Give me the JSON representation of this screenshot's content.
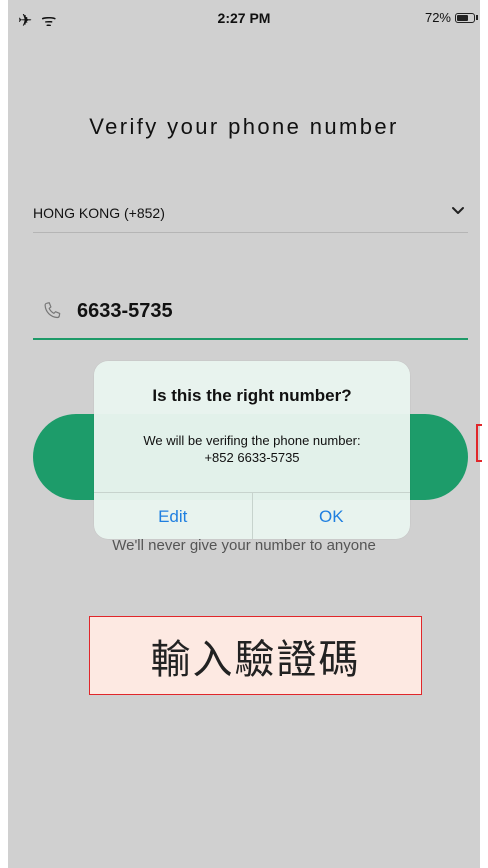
{
  "status_bar": {
    "left_icons": "✈ ᯤ",
    "time": "2:27 PM",
    "battery_percent": "72%",
    "battery_level": 0.72
  },
  "screen": {
    "title": "Verify your phone number",
    "country_selector": {
      "value": "HONG KONG (+852)",
      "icon": "chevron-down-icon"
    },
    "phone_field": {
      "value": "6633-5735",
      "icon": "phone-icon"
    },
    "privacy_note": "We'll never give your number to anyone"
  },
  "alert": {
    "title": "Is this the right number?",
    "message_line1": "We will be verifing the phone number:",
    "message_line2": "+852 6633-5735",
    "edit_label": "Edit",
    "ok_label": "OK"
  },
  "annotation": {
    "text": "輸入驗證碼"
  },
  "colors": {
    "accent_green": "#1d9c6a",
    "ios_blue": "#1f7fe0",
    "annotation_red": "#e0262a",
    "annotation_bg": "#fde9e2"
  }
}
